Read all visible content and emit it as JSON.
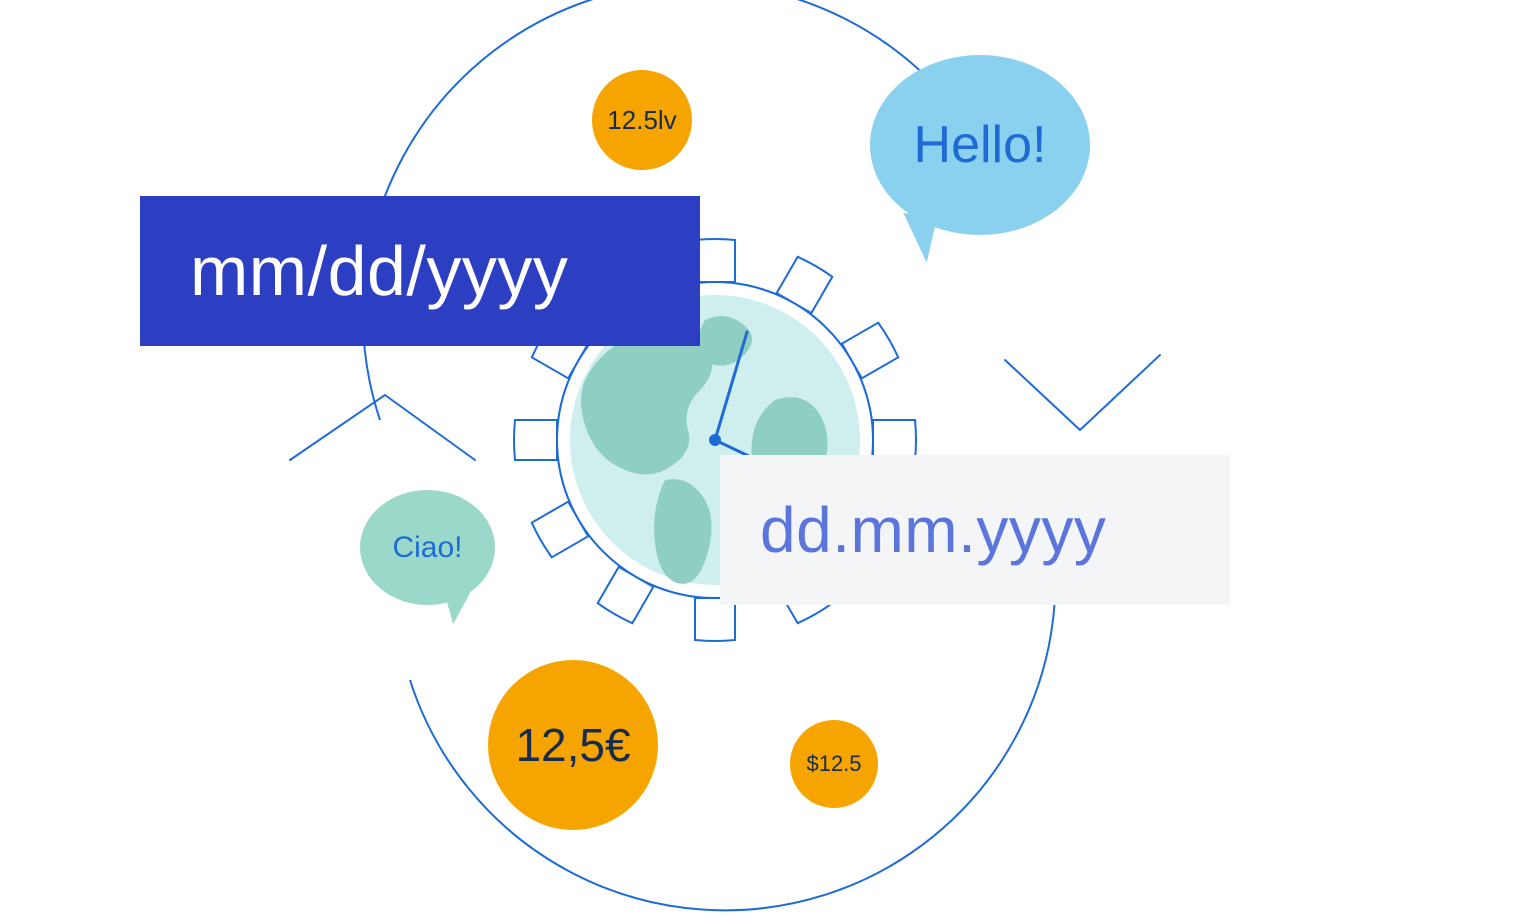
{
  "date_formats": {
    "us": "mm/dd/yyyy",
    "eu": "dd.mm.yyyy"
  },
  "currencies": {
    "lv": "12.5lv",
    "eur": "12,5€",
    "usd": "$12.5"
  },
  "greetings": {
    "en": "Hello!",
    "it": "Ciao!"
  },
  "colors": {
    "accent_blue": "#2C3FC2",
    "light_blue_text": "#5C75DC",
    "orange": "#F6A500",
    "sky": "#8AD1F0",
    "mint": "#9AD8C9",
    "stroke": "#1E6BD6",
    "panel_light": "#F4F5F7",
    "dark_text": "#172B4D"
  }
}
